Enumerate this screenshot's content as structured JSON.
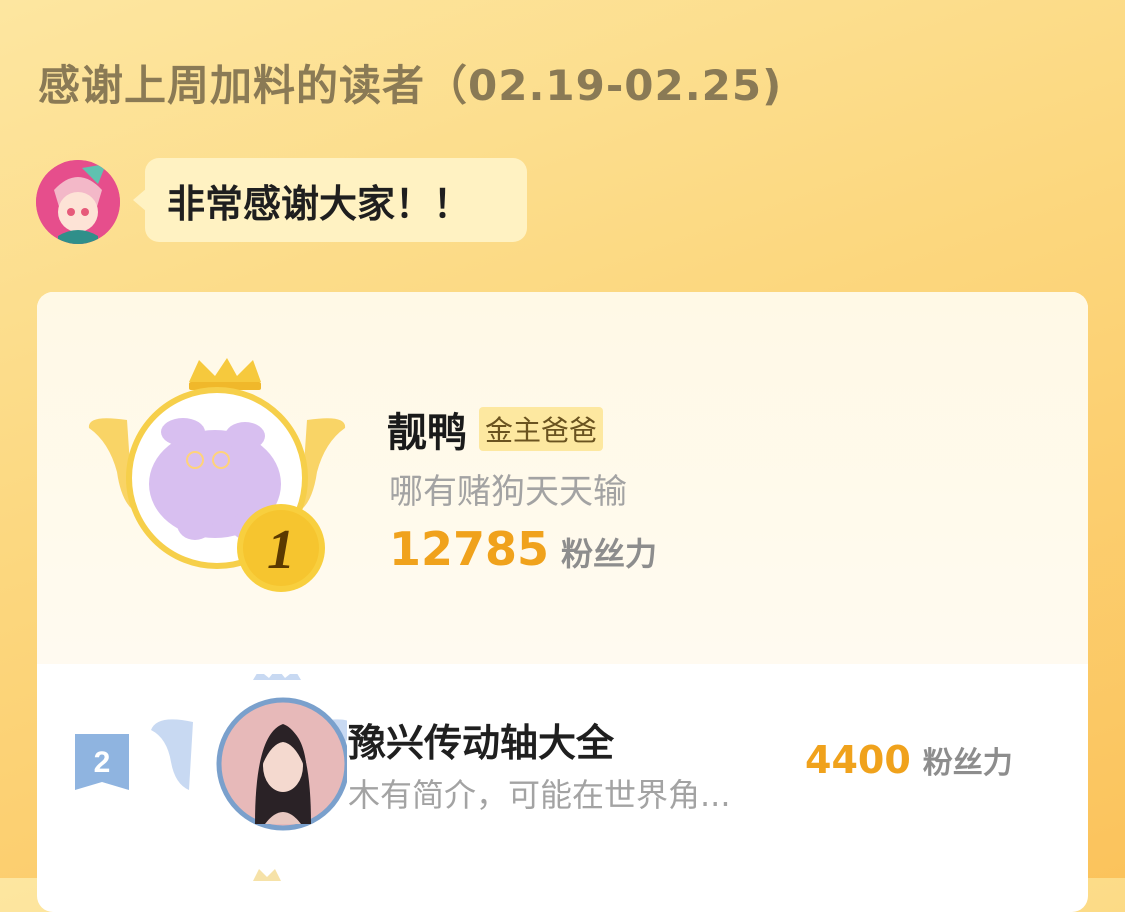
{
  "header": {
    "title": "感谢上周加料的读者（02.19-02.25)"
  },
  "greeting": {
    "message": "非常感谢大家！！"
  },
  "ranking": {
    "first": {
      "rank": "1",
      "name": "靓鸭",
      "tag": "金主爸爸",
      "bio": "哪有赌狗天天输",
      "fans_value": "12785",
      "fans_unit": "粉丝力"
    },
    "second": {
      "rank": "2",
      "name": "豫兴传动轴大全",
      "bio": "木有简介，可能在世界角...",
      "fans_value": "4400",
      "fans_unit": "粉丝力"
    }
  },
  "colors": {
    "accent_orange": "#f0a21c",
    "gold": "#f6c93d",
    "silver_blue": "#7aa0cc",
    "background_top": "#fde6a0",
    "background_bottom": "#fbc35c"
  },
  "icons": [
    "crown-icon",
    "wing-icon",
    "rank-medal-icon",
    "rank-flag-icon"
  ]
}
